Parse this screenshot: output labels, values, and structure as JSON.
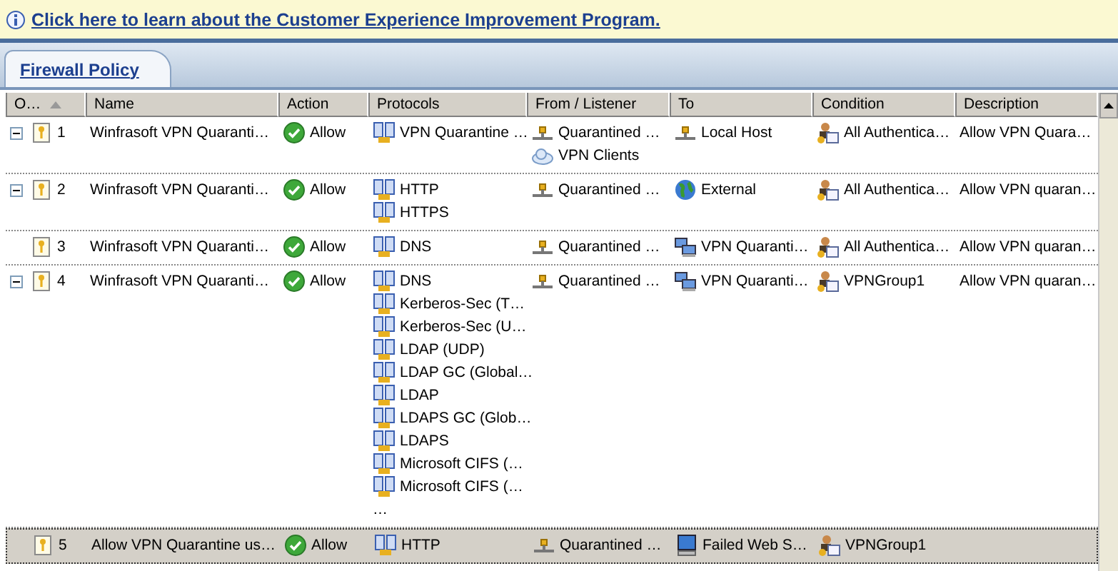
{
  "info_bar": {
    "link": "Click here to learn about the Customer Experience Improvement Program."
  },
  "tabs": [
    {
      "label": "Firewall Policy",
      "selected": true
    }
  ],
  "table": {
    "columns": [
      "O…",
      "Name",
      "Action",
      "Protocols",
      "From / Listener",
      "To",
      "Condition",
      "Description"
    ],
    "rows": [
      {
        "expanded": true,
        "selected": false,
        "order": "1",
        "name": "Winfrasoft VPN Quaranti…",
        "action": "Allow",
        "protocols": [
          "VPN Quarantine …"
        ],
        "from": [
          {
            "kind": "network",
            "text": "Quarantined …"
          },
          {
            "kind": "clients",
            "text": "VPN Clients"
          }
        ],
        "to": [
          {
            "kind": "network",
            "text": "Local Host"
          }
        ],
        "condition": "All Authentica…",
        "description": "Allow VPN Quara…"
      },
      {
        "expanded": true,
        "selected": false,
        "order": "2",
        "name": "Winfrasoft VPN Quaranti…",
        "action": "Allow",
        "protocols": [
          "HTTP",
          "HTTPS"
        ],
        "from": [
          {
            "kind": "network",
            "text": "Quarantined …"
          }
        ],
        "to": [
          {
            "kind": "globe",
            "text": "External"
          }
        ],
        "condition": "All Authentica…",
        "description": "Allow VPN quaran…"
      },
      {
        "selected": false,
        "order": "3",
        "name": "Winfrasoft VPN Quaranti…",
        "action": "Allow",
        "protocols": [
          "DNS"
        ],
        "from": [
          {
            "kind": "network",
            "text": "Quarantined …"
          }
        ],
        "to": [
          {
            "kind": "computers",
            "text": "VPN Quaranti…"
          }
        ],
        "condition": "All Authentica…",
        "description": "Allow VPN quaran…"
      },
      {
        "expanded": true,
        "selected": false,
        "order": "4",
        "name": "Winfrasoft VPN Quaranti…",
        "action": "Allow",
        "protocols": [
          "DNS",
          "Kerberos-Sec (T…",
          "Kerberos-Sec (U…",
          "LDAP (UDP)",
          "LDAP GC (Global…",
          "LDAP",
          "LDAPS GC (Glob…",
          "LDAPS",
          "Microsoft CIFS (…",
          "Microsoft CIFS (…"
        ],
        "more": "…",
        "from": [
          {
            "kind": "network",
            "text": "Quarantined …"
          }
        ],
        "to": [
          {
            "kind": "computers",
            "text": "VPN Quaranti…"
          }
        ],
        "condition": "VPNGroup1",
        "description": "Allow VPN quaran…"
      },
      {
        "selected": true,
        "order": "5",
        "name": "Allow VPN Quarantine us…",
        "action": "Allow",
        "protocols": [
          "HTTP"
        ],
        "from": [
          {
            "kind": "network",
            "text": "Quarantined …"
          }
        ],
        "to": [
          {
            "kind": "monitor",
            "text": "Failed Web S…"
          }
        ],
        "condition": "VPNGroup1"
      }
    ]
  }
}
